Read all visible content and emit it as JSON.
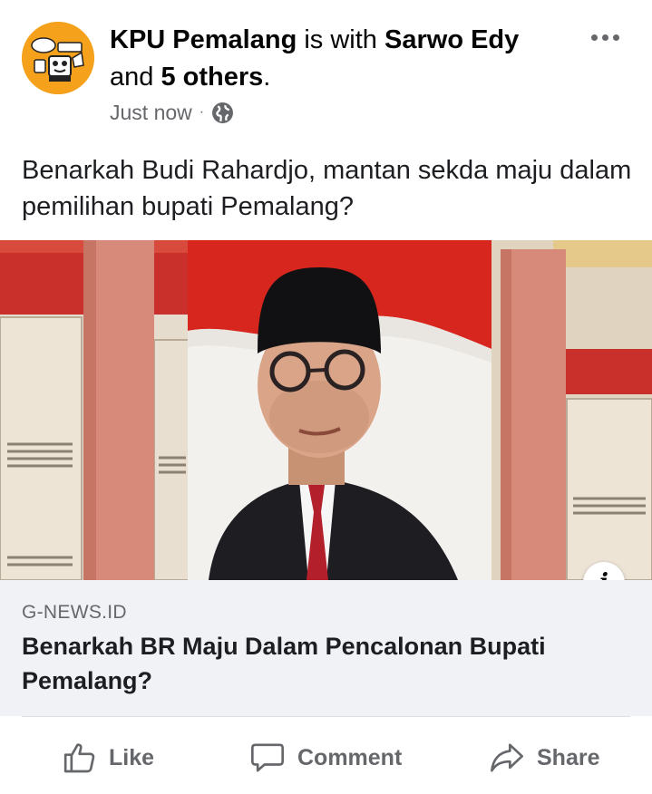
{
  "post": {
    "author": "KPU Pemalang",
    "with_text": "is with",
    "tagged_person": "Sarwo Edy",
    "and_text": "and",
    "others": "5 others",
    "period": ".",
    "timestamp": "Just now",
    "separator": "·",
    "privacy_icon": "globe-icon",
    "body": "Benarkah Budi Rahardjo, mantan sekda maju dalam pemilihan bupati Pemalang?"
  },
  "link_preview": {
    "domain": "G-NEWS.ID",
    "title": "Benarkah BR Maju Dalam Pencalonan Bupati Pemalang?",
    "info_label": "i"
  },
  "actions": {
    "like": "Like",
    "comment": "Comment",
    "share": "Share"
  },
  "colors": {
    "avatar_bg": "#f5a11c",
    "secondary_text": "#65676b",
    "card_bg": "#f0f2f5"
  }
}
